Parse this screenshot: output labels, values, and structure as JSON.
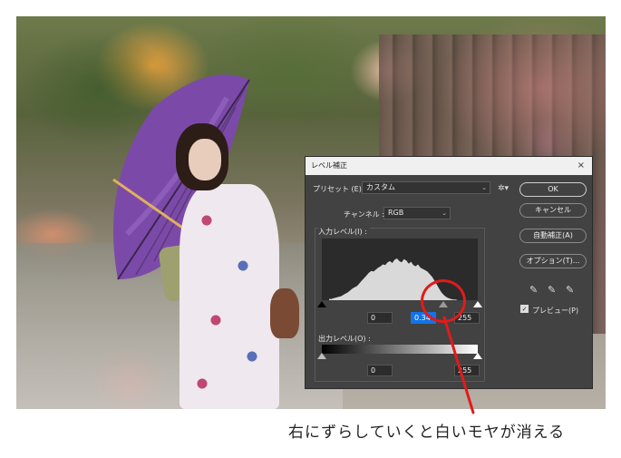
{
  "dialog": {
    "title": "レベル補正",
    "close_glyph": "×",
    "preset_label": "プリセット (E) :",
    "preset_value": "カスタム",
    "channel_label": "チャンネル :",
    "channel_value": "RGB",
    "input_levels_label": "入力レベル(I) :",
    "input_values": [
      "0",
      "0.34",
      "255"
    ],
    "output_levels_label": "出力レベル(O) :",
    "output_values": [
      "0",
      "255"
    ],
    "buttons": {
      "ok": "OK",
      "cancel": "キャンセル",
      "auto": "自動補正(A)",
      "options": "オプション(T)..."
    },
    "preview_label": "プレビュー(P)",
    "preview_checked": true
  },
  "icons": {
    "gear": "gear-icon",
    "eyedroppers": [
      "black-eyedropper-icon",
      "gray-eyedropper-icon",
      "white-eyedropper-icon"
    ]
  },
  "histogram": [
    2,
    2,
    3,
    4,
    5,
    6,
    8,
    10,
    12,
    15,
    18,
    20,
    22,
    26,
    30,
    34,
    38,
    42,
    45,
    44,
    47,
    50,
    52,
    55,
    54,
    58,
    60,
    57,
    62,
    64,
    60,
    58,
    63,
    61,
    56,
    59,
    54,
    52,
    55,
    50,
    48,
    46,
    44,
    40,
    36,
    30,
    24,
    18,
    12,
    8,
    5,
    3,
    2,
    1,
    1,
    0
  ],
  "annotation": {
    "caption": "右にずらしていくと白いモヤが消える",
    "color": "#e11b1b"
  }
}
